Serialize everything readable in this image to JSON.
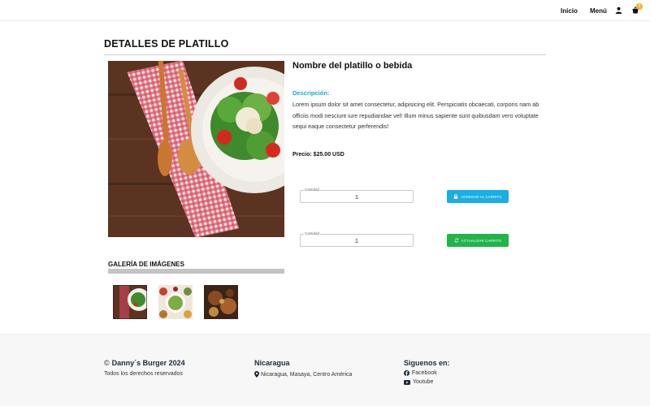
{
  "header": {
    "nav": {
      "home": "Inicio",
      "menu": "Menú"
    },
    "cart_count": "2"
  },
  "page_title": "DETALLES DE PLATILLO",
  "dish": {
    "name": "Nombre del platillo o bebida",
    "description_heading": "Descripción:",
    "description": "Lorem ipsum dolor sit amet consectetur, adipisicing elit. Perspiciatis obcaecati, corporis nam ab officiis modi nesciunt iure repudiandae vel! Illum minus sapiente sunt quibusdam vero voluptate sequi eaque consectetur perferendis!",
    "price": "Precio: $25.00 USD"
  },
  "order": {
    "quantity_label": "Cantidad",
    "quantity_value": "1",
    "add_button": "AGREGAR AL CARRITO",
    "update_quantity_value": "1",
    "update_button": "ACTUALIZAR CARRITO"
  },
  "gallery": {
    "title": "GALERÍA DE IMÁGENES"
  },
  "footer": {
    "copyright_symbol": "©",
    "copyright": "Danny´s Burger 2024",
    "rights": "Todos los derechos reservados",
    "country": "Nicaragua",
    "location": "Nicaragua, Masaya, Centro América",
    "follow_heading": "Siguenos en:",
    "facebook": "Facebook",
    "youtube": "Youtube"
  },
  "colors": {
    "accent": "#12a9d6",
    "add_button": "#1aaee3",
    "update_button": "#1fb54a",
    "badge": "#f0b429"
  },
  "icons": [
    "user-icon",
    "cart-icon",
    "lock-icon",
    "refresh-icon",
    "map-pin-icon",
    "facebook-icon",
    "youtube-icon"
  ]
}
